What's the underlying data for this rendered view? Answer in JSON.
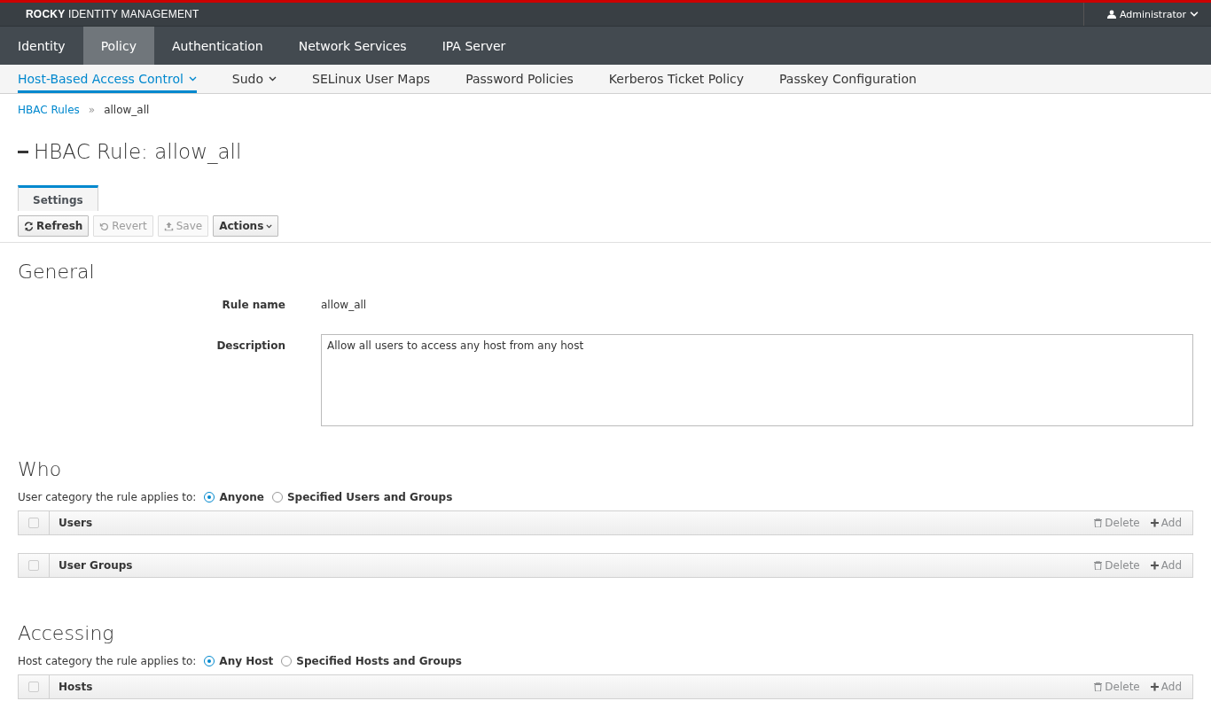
{
  "header": {
    "brand_bold": "ROCKY",
    "brand_rest": "IDENTITY MANAGEMENT",
    "user": "Administrator"
  },
  "main_nav": [
    {
      "label": "Identity",
      "selected": false
    },
    {
      "label": "Policy",
      "selected": true
    },
    {
      "label": "Authentication",
      "selected": false
    },
    {
      "label": "Network Services",
      "selected": false
    },
    {
      "label": "IPA Server",
      "selected": false
    }
  ],
  "sub_nav": [
    {
      "label": "Host-Based Access Control",
      "selected": true,
      "dropdown": true
    },
    {
      "label": "Sudo",
      "selected": false,
      "dropdown": true
    },
    {
      "label": "SELinux User Maps",
      "selected": false,
      "dropdown": false
    },
    {
      "label": "Password Policies",
      "selected": false,
      "dropdown": false
    },
    {
      "label": "Kerberos Ticket Policy",
      "selected": false,
      "dropdown": false
    },
    {
      "label": "Passkey Configuration",
      "selected": false,
      "dropdown": false
    }
  ],
  "breadcrumb": {
    "link": "HBAC Rules",
    "separator": "»",
    "current": "allow_all"
  },
  "title": "HBAC Rule: allow_all",
  "tabs": [
    {
      "label": "Settings",
      "selected": true
    }
  ],
  "toolbar": [
    {
      "kind": "refresh",
      "label": "Refresh",
      "disabled": false
    },
    {
      "kind": "revert",
      "label": "Revert",
      "disabled": true
    },
    {
      "kind": "save",
      "label": "Save",
      "disabled": true
    },
    {
      "kind": "actions",
      "label": "Actions",
      "disabled": false
    }
  ],
  "general": {
    "heading": "General",
    "rule_name_label": "Rule name",
    "rule_name": "allow_all",
    "description_label": "Description",
    "description": "Allow all users to access any host from any host"
  },
  "sections": [
    {
      "heading": "Who",
      "category_label": "User category the rule applies to:",
      "options": [
        {
          "label": "Anyone",
          "selected": true
        },
        {
          "label": "Specified Users and Groups",
          "selected": false
        }
      ],
      "tables": [
        {
          "title": "Users",
          "checked": false,
          "delete": "Delete",
          "add": "Add"
        },
        {
          "title": "User Groups",
          "checked": false,
          "delete": "Delete",
          "add": "Add"
        }
      ]
    },
    {
      "heading": "Accessing",
      "category_label": "Host category the rule applies to:",
      "options": [
        {
          "label": "Any Host",
          "selected": true
        },
        {
          "label": "Specified Hosts and Groups",
          "selected": false
        }
      ],
      "tables": [
        {
          "title": "Hosts",
          "checked": false,
          "delete": "Delete",
          "add": "Add"
        }
      ]
    }
  ]
}
